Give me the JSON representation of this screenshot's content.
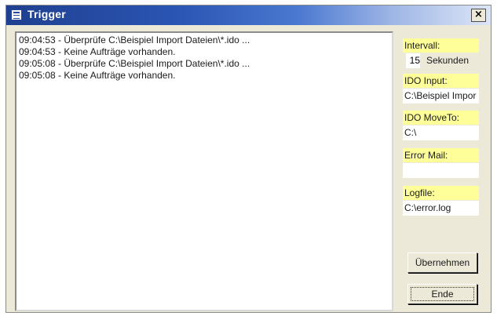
{
  "window": {
    "title": "Trigger",
    "close_label": "×"
  },
  "log": {
    "lines": [
      "09:04:53 - Überprüfe C:\\Beispiel Import Dateien\\*.ido ...",
      "09:04:53 - Keine Aufträge vorhanden.",
      "09:05:08 - Überprüfe C:\\Beispiel Import Dateien\\*.ido ...",
      "09:05:08 - Keine Aufträge vorhanden."
    ]
  },
  "settings": {
    "interval_label": "Intervall:",
    "interval_value": "15",
    "interval_unit": "Sekunden",
    "ido_input_label": "IDO Input:",
    "ido_input_value": "C:\\Beispiel Impor",
    "ido_moveto_label": "IDO MoveTo:",
    "ido_moveto_value": "C:\\",
    "error_mail_label": "Error Mail:",
    "error_mail_value": "",
    "logfile_label": "Logfile:",
    "logfile_value": "C:\\error.log"
  },
  "buttons": {
    "apply_label": "Übernehmen",
    "end_label": "Ende"
  },
  "colors": {
    "label_bg": "#ffff99",
    "title_bar": "#2a55b3",
    "window_bg": "#ece9d8"
  },
  "icons": {
    "title": "window-app-icon",
    "close": "close-icon"
  }
}
